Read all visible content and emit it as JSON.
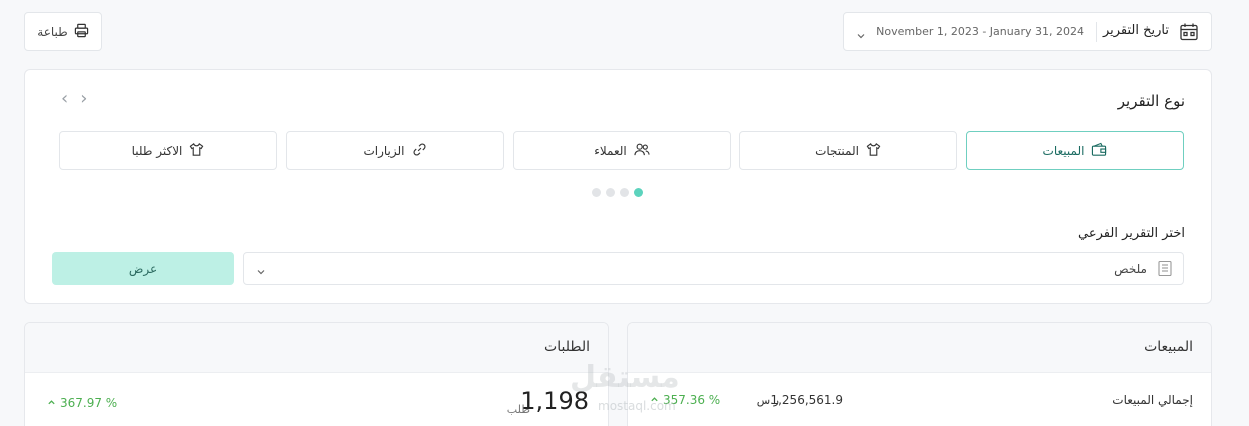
{
  "topbar": {
    "print_label": "طباعة",
    "date_label": "تاريخ التقرير",
    "date_range": "November 1, 2023 - January 31, 2024"
  },
  "report": {
    "title": "نوع التقرير",
    "types": [
      {
        "label": "المبيعات",
        "icon": "wallet-icon",
        "active": true
      },
      {
        "label": "المنتجات",
        "icon": "tshirt-icon",
        "active": false
      },
      {
        "label": "العملاء",
        "icon": "users-icon",
        "active": false
      },
      {
        "label": "الزيارات",
        "icon": "link-icon",
        "active": false
      },
      {
        "label": "الاكثر طلبا",
        "icon": "tshirt-icon",
        "active": false
      }
    ],
    "pager": {
      "total": 4,
      "active": 0
    },
    "sub_label": "اختر التقرير الفرعي",
    "sub_value": "ملخص",
    "show_label": "عرض"
  },
  "sales": {
    "title": "المبيعات",
    "row_label": "إجمالي المبيعات",
    "amount": "1,256,561.9",
    "currency": "ر.س",
    "change": "357.36 %"
  },
  "orders": {
    "title": "الطلبات",
    "count": "1,198",
    "unit": "طلب",
    "change": "367.97 %"
  },
  "watermark": {
    "main": "مستقل",
    "sub": "mostaql.com"
  },
  "colors": {
    "accent": "#5cd3bd",
    "accent_light": "#bdf0e5",
    "positive": "#4caf50"
  }
}
